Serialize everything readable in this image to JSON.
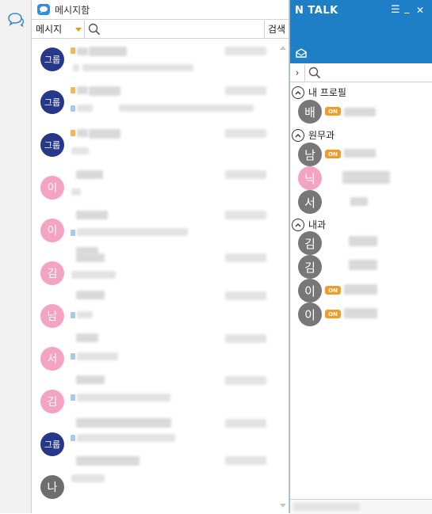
{
  "app": {
    "rail_icon": "chat-bubbles-icon"
  },
  "message_panel": {
    "title": "메시지함",
    "filter_label": "메시지",
    "search_placeholder": "",
    "search_button": "검색",
    "rows": [
      {
        "avatar": "그룹",
        "color": "#27378a",
        "kind": "group"
      },
      {
        "avatar": "그룹",
        "color": "#27378a",
        "kind": "group"
      },
      {
        "avatar": "그룹",
        "color": "#27378a",
        "kind": "group"
      },
      {
        "avatar": "이",
        "color": "#f4a3c3",
        "kind": "person"
      },
      {
        "avatar": "이",
        "color": "#f4a3c3",
        "kind": "person"
      },
      {
        "avatar": "김",
        "color": "#f4a3c3",
        "kind": "person"
      },
      {
        "avatar": "남",
        "color": "#f4a3c3",
        "kind": "person"
      },
      {
        "avatar": "서",
        "color": "#f4a3c3",
        "kind": "person"
      },
      {
        "avatar": "김",
        "color": "#f4a3c3",
        "kind": "person"
      },
      {
        "avatar": "그룹",
        "color": "#27378a",
        "kind": "group"
      },
      {
        "avatar": "나",
        "color": "#6e6e6e",
        "kind": "person"
      }
    ]
  },
  "ntalk": {
    "title": "N TALK",
    "controls": {
      "menu": "☰",
      "minimize": "_",
      "close": "✕"
    },
    "groups": [
      {
        "label": "내 프로필",
        "members": [
          {
            "avatar": "배",
            "color": "#777777",
            "online": true,
            "on_label": "ON"
          }
        ]
      },
      {
        "label": "원무과",
        "members": [
          {
            "avatar": "남",
            "color": "#777777",
            "online": true,
            "on_label": "ON"
          },
          {
            "avatar": "닉",
            "color": "#f4a3c3",
            "online": false,
            "on_label": ""
          },
          {
            "avatar": "서",
            "color": "#777777",
            "online": false,
            "on_label": ""
          }
        ]
      },
      {
        "label": "내과",
        "members": [
          {
            "avatar": "김",
            "color": "#777777",
            "online": false,
            "on_label": ""
          },
          {
            "avatar": "김",
            "color": "#777777",
            "online": false,
            "on_label": ""
          },
          {
            "avatar": "이",
            "color": "#777777",
            "online": true,
            "on_label": "ON"
          },
          {
            "avatar": "이",
            "color": "#777777",
            "online": true,
            "on_label": "ON"
          }
        ]
      }
    ]
  },
  "colors": {
    "accent": "#1f7fc6",
    "online_badge": "#f39a2b",
    "group_avatar": "#27378a",
    "pink_avatar": "#f4a3c3"
  }
}
